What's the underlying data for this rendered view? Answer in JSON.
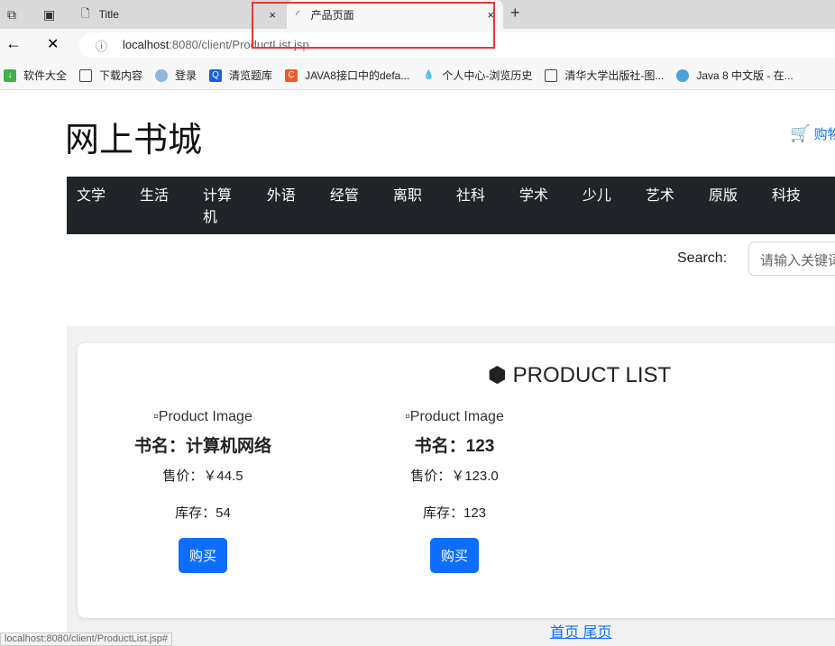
{
  "browser": {
    "tabs": [
      {
        "label": "Title",
        "close": "×"
      },
      {
        "label": "产品页面",
        "close": "×"
      }
    ],
    "new_tab": "+",
    "url_host": "localhost",
    "url_path": ":8080/client/ProductList.jsp",
    "bookmarks": [
      "软件大全",
      "下载内容",
      "登录",
      "清览题库",
      "JAVA8接口中的defa...",
      "个人中心-浏览历史",
      "清华大学出版社-图...",
      "Java 8 中文版 - 在..."
    ],
    "status_url": "localhost:8080/client/ProductList.jsp#"
  },
  "header": {
    "logo": "网上书城",
    "cart": "购物车"
  },
  "nav": [
    "文学",
    "生活",
    "计算机",
    "外语",
    "经管",
    "离职",
    "社科",
    "学术",
    "少儿",
    "艺术",
    "原版",
    "科技"
  ],
  "search": {
    "label": "Search:",
    "placeholder": "请输入关键词"
  },
  "main": {
    "title": "PRODUCT LIST",
    "products": [
      {
        "img_alt": "Product Image",
        "name": "书名：计算机网络",
        "price": "售价：￥44.5",
        "stock": "库存：54",
        "buy": "购买"
      },
      {
        "img_alt": "Product Image",
        "name": "书名：123",
        "price": "售价：￥123.0",
        "stock": "库存：123",
        "buy": "购买"
      }
    ],
    "pager": {
      "first": "首页",
      "last": "尾页"
    }
  }
}
